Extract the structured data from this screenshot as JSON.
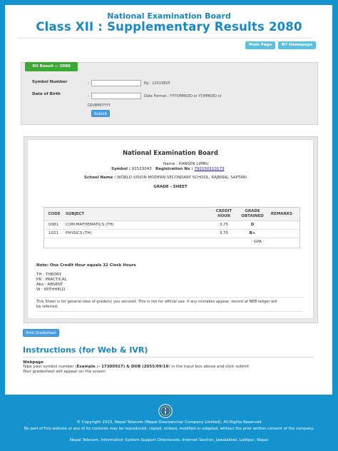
{
  "header": {
    "board": "National Examination Board",
    "title": "Class XII : Supplementary Results 2080",
    "buttons": [
      "Main Page",
      "NT Homepage"
    ]
  },
  "form": {
    "tab": "XII Result :: 2080",
    "symbol_label": "Symbol Number",
    "symbol_hint": "Eg : 12013825",
    "dob_label": "Date of Birth",
    "dob_hint_1": "Date Format : YYYY/MM/DD or YY/MM/DD or",
    "dob_hint_2": "DD/MM/YYYY",
    "colon": ":",
    "submit": "Submit"
  },
  "sheet": {
    "board": "National Examination Board",
    "name_label": "Name :",
    "name": "HANSEN LIMBU",
    "symbol_label": "Symbol :",
    "symbol": "91523043",
    "reg_label": "Registration No :",
    "reg": "792150110173",
    "school_label": "School Name :",
    "school": "WORLD VISION MODERN SECONDARY SCHOOL, RAJBIRAJ, SAPTARI",
    "grade_sheet": "GRADE - SHEET",
    "columns": [
      "CODE",
      "SUBJECT",
      "CREDIT HOUR",
      "GRADE OBTAINED",
      "REMARKS"
    ],
    "rows": [
      {
        "code": "0081",
        "subject": "COM.MATHEMATICS (TH)",
        "credit": "3.75",
        "grade": "D"
      },
      {
        "code": "1021",
        "subject": "PHYSICS (TH)",
        "credit": "3.75",
        "grade": "B+"
      }
    ],
    "gpa_label": "GPA :",
    "note": "Note: One Credit Hour equals 32 Clock Hours",
    "legend": [
      "TH : THEORY",
      "PR : PRACTICAL",
      "Abs : ABSENT",
      "W : WITHHELD"
    ],
    "disclaimer_1": "This Sheet is for general idea of grade(s) you secured. This is not for official use. If any mistakes appear, record at NEB ledger will",
    "disclaimer_2": "be referred."
  },
  "print_button": "Print Gradesheet",
  "instructions": {
    "title": "Instructions (for Web & IVR)",
    "subtitle": "Webpage",
    "line1_a": "Type your symbol number (",
    "line1_b": "Example :- 17300927) & DOB (2055/09/19",
    "line1_c": ") in the input box above and click submit",
    "line2": "Your gradesheet will appear on the screen"
  },
  "footer": {
    "copyright": "© Copyright 2023, Nepal Telecom (Nepal Doorsanchar Company Limited), All Rights Reserved",
    "notice": "No part of this website or any of its contents may be reproduced, copied, embed, modified or adapted, without the prior written consent of the company.",
    "dept": "Nepal Telecom, Information System Support Directorate, Internet Section, Jawalakhel, Lalitpur, Nepal"
  },
  "colors": {
    "brand_blue": "#1593cf",
    "title_blue": "#1b87c2",
    "green": "#3aa832",
    "button_cyan": "#5bc0de",
    "button_blue": "#4a9fe0"
  },
  "icons": [
    "nepal-telecom-logo-icon"
  ]
}
